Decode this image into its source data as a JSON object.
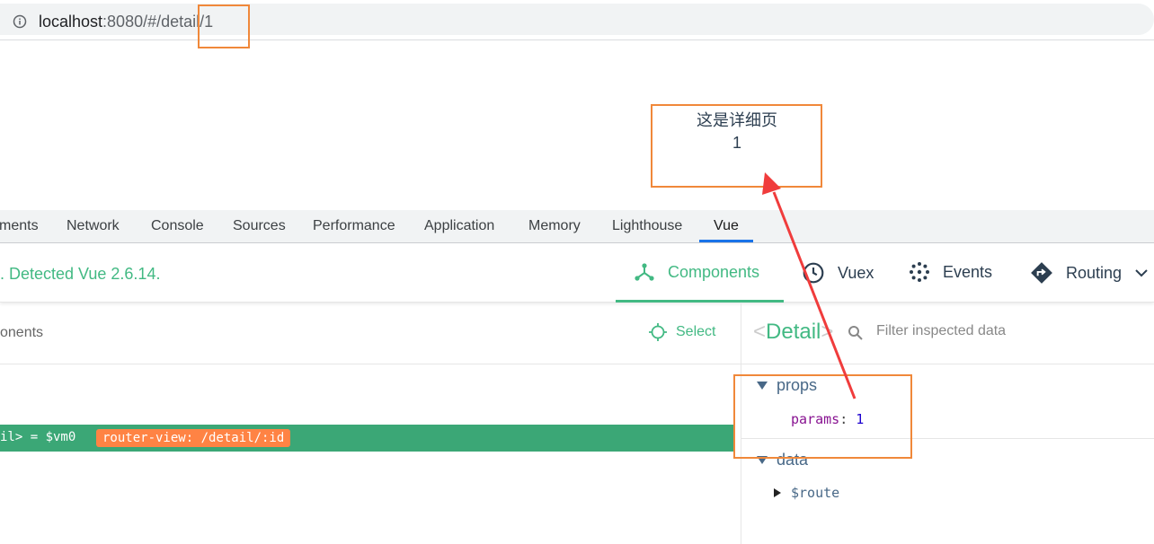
{
  "address_bar": {
    "host": "localhost",
    "rest": ":8080/#/detail/1"
  },
  "page": {
    "heading": "这是详细页",
    "id_value": "1"
  },
  "devtools_tabs": [
    {
      "label": "ments"
    },
    {
      "label": "Network"
    },
    {
      "label": "Console"
    },
    {
      "label": "Sources"
    },
    {
      "label": "Performance"
    },
    {
      "label": "Application"
    },
    {
      "label": "Memory"
    },
    {
      "label": "Lighthouse"
    },
    {
      "label": "Vue"
    }
  ],
  "vue": {
    "detected": ". Detected Vue 2.6.14.",
    "tabs": {
      "components": "Components",
      "vuex": "Vuex",
      "events": "Events",
      "routing": "Routing"
    },
    "components_title": "onents",
    "select_label": "Select",
    "tree_row": {
      "name": "il> = $vm0",
      "badge": "router-view: /detail/:id"
    },
    "inspector": {
      "open": "<",
      "name": "Detail",
      "close": ">",
      "filter_placeholder": "Filter inspected data",
      "props_label": "props",
      "param_key": "params",
      "param_colon": ":",
      "param_value": "1",
      "data_label": "data",
      "route_key": "$route"
    }
  },
  "colors": {
    "vue_green": "#42b983",
    "annotation_orange": "#f0883a",
    "arrow_red": "#f03c3c",
    "badge_orange": "#ff8344"
  }
}
